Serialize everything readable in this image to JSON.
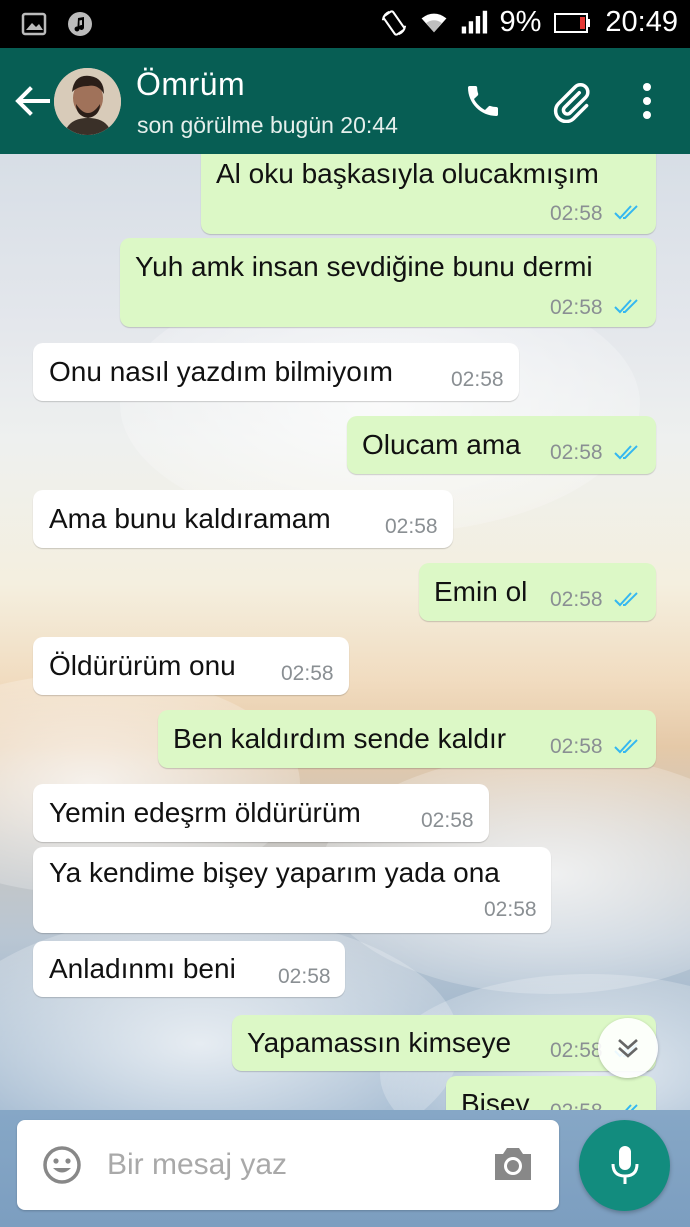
{
  "status_bar": {
    "battery": "9%",
    "time": "20:49"
  },
  "header": {
    "name": "Ömrüm",
    "status": "son görülme bugün 20:44"
  },
  "messages": [
    {
      "dir": "out",
      "text": "Al oku başkasıyla olucakmışım",
      "time": "02:58",
      "ticks": "read"
    },
    {
      "dir": "out",
      "text": "Yuh amk insan sevdiğine bunu dermi",
      "time": "02:58",
      "ticks": "read"
    },
    {
      "dir": "in",
      "text": "Onu nasıl yazdım bilmiyoım",
      "time": "02:58"
    },
    {
      "dir": "out",
      "text": "Olucam ama",
      "time": "02:58",
      "ticks": "read"
    },
    {
      "dir": "in",
      "text": "Ama bunu kaldıramam",
      "time": "02:58"
    },
    {
      "dir": "out",
      "text": "Emin ol",
      "time": "02:58",
      "ticks": "read"
    },
    {
      "dir": "in",
      "text": "Öldürürüm onu",
      "time": "02:58"
    },
    {
      "dir": "out",
      "text": "Ben kaldırdım sende kaldır",
      "time": "02:58",
      "ticks": "read"
    },
    {
      "dir": "in",
      "text": "Yemin edeşrm öldürürüm",
      "time": "02:58"
    },
    {
      "dir": "in",
      "text": "Ya kendime bişey yaparım yada ona",
      "time": "02:58"
    },
    {
      "dir": "in",
      "text": "Anladınmı beni",
      "time": "02:58"
    },
    {
      "dir": "out",
      "text": "Yapamassın kimseye",
      "time": "02:58",
      "ticks": "read"
    },
    {
      "dir": "out",
      "text": "Bişey",
      "time": "02:58",
      "ticks": "read"
    }
  ],
  "composer": {
    "placeholder": "Bir mesaj yaz"
  },
  "colors": {
    "header": "#075e54",
    "outgoing": "#dcf8c6",
    "incoming": "#ffffff",
    "read_ticks": "#34b7f1",
    "mic": "#128c7e"
  },
  "icons": [
    "back-arrow-icon",
    "phone-icon",
    "paperclip-icon",
    "more-vert-icon",
    "emoji-icon",
    "camera-icon",
    "mic-icon",
    "chevron-down-icon"
  ]
}
